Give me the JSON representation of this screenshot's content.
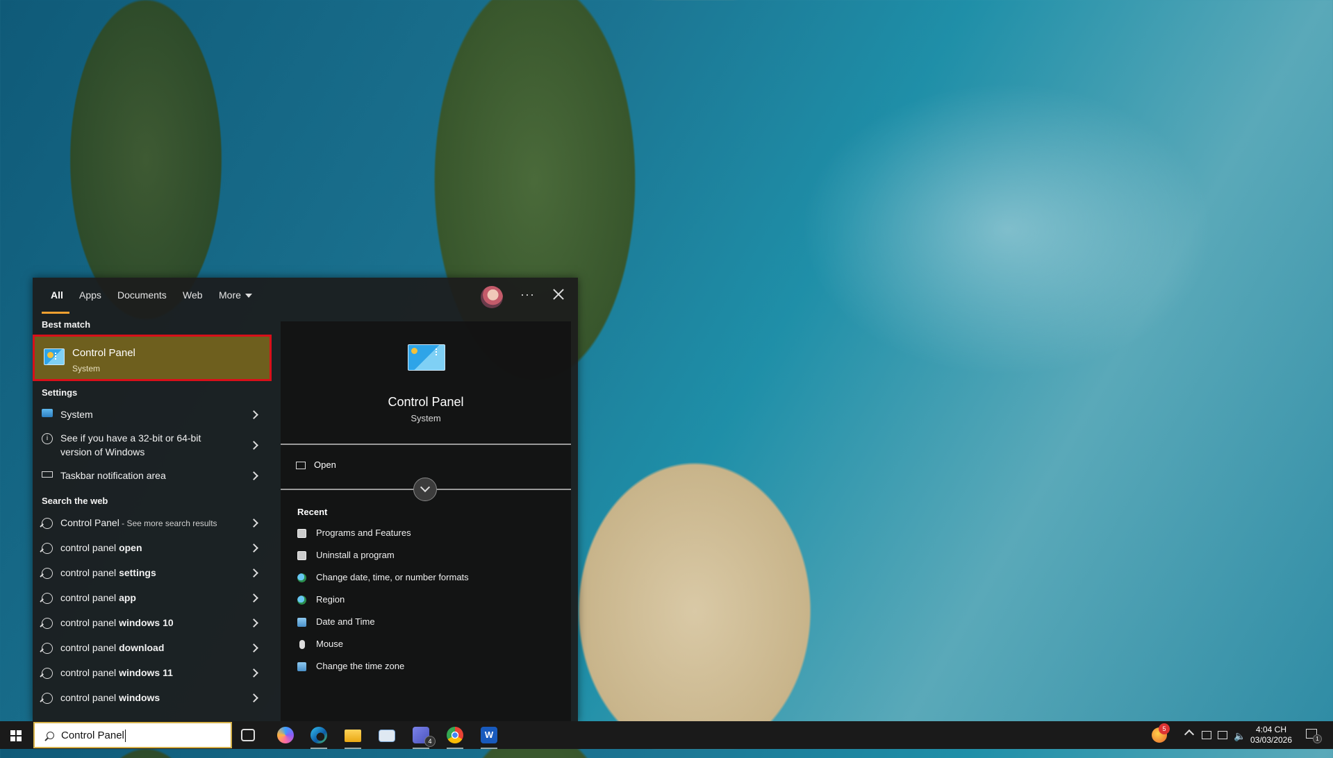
{
  "search_panel": {
    "tabs": [
      {
        "label": "All",
        "active": true
      },
      {
        "label": "Apps"
      },
      {
        "label": "Documents"
      },
      {
        "label": "Web"
      },
      {
        "label": "More"
      }
    ],
    "header_icons": [
      "avatar",
      "ellipsis-icon",
      "close-icon"
    ],
    "best_match": {
      "section": "Best match",
      "title": "Control Panel",
      "subtitle": "System",
      "icon": "control-panel-icon"
    },
    "settings": {
      "section": "Settings",
      "items": [
        {
          "label": "System",
          "icon": "monitor-icon"
        },
        {
          "label_line1": "See if you have a 32-bit or 64-bit",
          "label_line2": "version of Windows",
          "icon": "info-icon"
        },
        {
          "label": "Taskbar notification area",
          "icon": "taskbar-icon"
        }
      ]
    },
    "web": {
      "section": "Search the web",
      "first": {
        "label": "Control Panel",
        "suffix": " - See more search results"
      },
      "items": [
        {
          "prefix": "control panel ",
          "bold": "open"
        },
        {
          "prefix": "control panel ",
          "bold": "settings"
        },
        {
          "prefix": "control panel ",
          "bold": "app"
        },
        {
          "prefix": "control panel ",
          "bold": "windows 10"
        },
        {
          "prefix": "control panel ",
          "bold": "download"
        },
        {
          "prefix": "control panel ",
          "bold": "windows 11"
        },
        {
          "prefix": "control panel ",
          "bold": "windows"
        }
      ]
    },
    "preview": {
      "title": "Control Panel",
      "subtitle": "System",
      "open_label": "Open",
      "recent_title": "Recent",
      "recent": [
        {
          "label": "Programs and Features",
          "icon": "program-icon"
        },
        {
          "label": "Uninstall a program",
          "icon": "program-icon"
        },
        {
          "label": "Change date, time, or number formats",
          "icon": "globe-icon"
        },
        {
          "label": "Region",
          "icon": "globe-icon"
        },
        {
          "label": "Date and Time",
          "icon": "clock-icon"
        },
        {
          "label": "Mouse",
          "icon": "mouse-icon"
        },
        {
          "label": "Change the time zone",
          "icon": "clock-icon"
        }
      ]
    }
  },
  "taskbar": {
    "search_value": "Control Panel",
    "apps": [
      "task-view-icon",
      "copilot-icon",
      "edge-icon",
      "file-explorer-icon",
      "mail-icon",
      "teams-icon",
      "chrome-icon",
      "word-icon"
    ],
    "teams_badge": "4",
    "tray_badge": "5",
    "clock_time": "4:04 CH",
    "clock_date": "03/03/2026",
    "notification_count": "1"
  },
  "colors": {
    "accent": "#f0a030",
    "best_match_bg": "#6e5f1e",
    "highlight_border": "#d8101a"
  }
}
